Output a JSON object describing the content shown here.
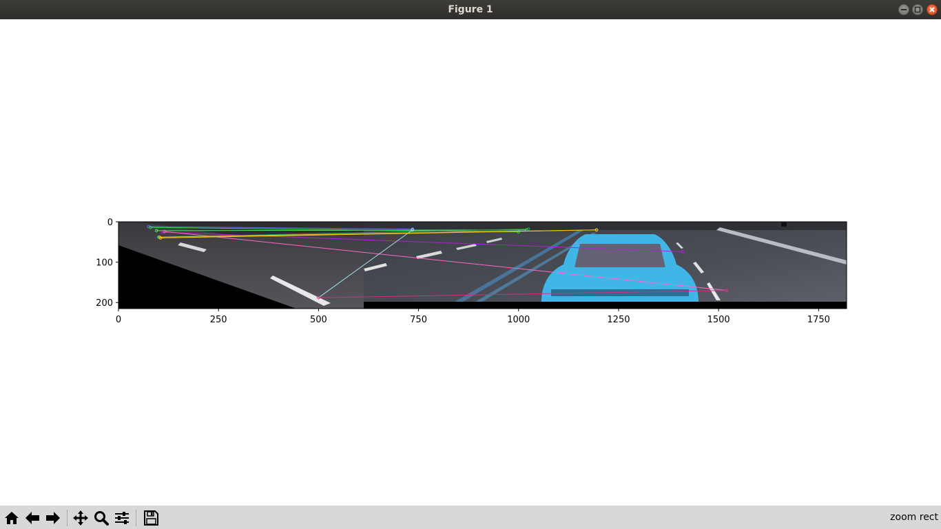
{
  "window": {
    "title": "Figure 1"
  },
  "toolbar": {
    "buttons": [
      {
        "name": "home-button",
        "icon": "home-icon"
      },
      {
        "name": "back-button",
        "icon": "arrow-left-icon"
      },
      {
        "name": "forward-button",
        "icon": "arrow-right-icon"
      },
      {
        "name": "pan-button",
        "icon": "move-icon"
      },
      {
        "name": "zoom-button",
        "icon": "magnifier-icon"
      },
      {
        "name": "configure-subplots-button",
        "icon": "sliders-icon"
      },
      {
        "name": "save-button",
        "icon": "floppy-disk-icon"
      }
    ],
    "status": "zoom rect"
  },
  "axes": {
    "xticks": [
      "0",
      "250",
      "500",
      "750",
      "1000",
      "1250",
      "1500",
      "1750"
    ],
    "yticks": [
      "0",
      "100",
      "200"
    ],
    "xlim": [
      0,
      1820
    ],
    "ylim": [
      215,
      0
    ]
  },
  "matches": [
    {
      "x1": 75,
      "y1": 12,
      "x2": 735,
      "y2": 18,
      "color": "#6a6aff"
    },
    {
      "x1": 80,
      "y1": 14,
      "x2": 1000,
      "y2": 25,
      "color": "#31d84f"
    },
    {
      "x1": 95,
      "y1": 22,
      "x2": 1020,
      "y2": 20,
      "color": "#5fe06f"
    },
    {
      "x1": 100,
      "y1": 38,
      "x2": 1025,
      "y2": 18,
      "color": "#22aa55"
    },
    {
      "x1": 110,
      "y1": 26,
      "x2": 1410,
      "y2": 74,
      "color": "#b21fd6"
    },
    {
      "x1": 115,
      "y1": 24,
      "x2": 1520,
      "y2": 170,
      "color": "#ff66cc"
    },
    {
      "x1": 102,
      "y1": 38,
      "x2": 1195,
      "y2": 20,
      "color": "#f0b030"
    },
    {
      "x1": 500,
      "y1": 188,
      "x2": 735,
      "y2": 20,
      "color": "#a8e0e8"
    },
    {
      "x1": 500,
      "y1": 188,
      "x2": 1520,
      "y2": 170,
      "color": "#d03080"
    },
    {
      "x1": 105,
      "y1": 40,
      "x2": 1195,
      "y2": 20,
      "color": "#ffcc00"
    }
  ]
}
